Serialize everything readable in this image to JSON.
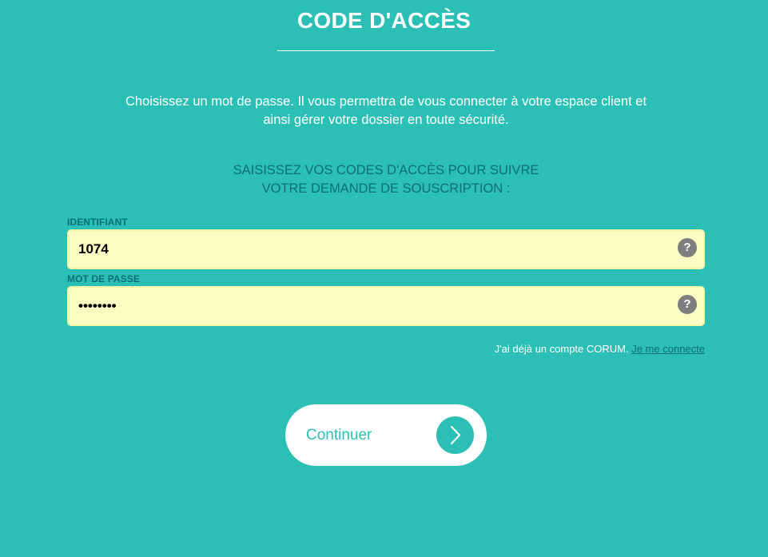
{
  "header": {
    "title": "CODE D'ACCÈS"
  },
  "intro": {
    "line1": "Choisissez un mot de passe. Il vous permettra de vous connecter à votre espace client et",
    "line2": "ainsi gérer votre dossier en toute sécurité."
  },
  "subheading": {
    "line1": "SAISISSEZ VOS CODES D'ACCÈS POUR SUIVRE",
    "line2": "VOTRE DEMANDE DE SOUSCRIPTION :"
  },
  "form": {
    "identifiant": {
      "label": "IDENTIFIANT",
      "value": "1074",
      "help_icon": "?"
    },
    "password": {
      "label": "MOT DE PASSE",
      "value": "12345678",
      "help_icon": "?"
    }
  },
  "account": {
    "text": "J'ai déjà un compte CORUM. ",
    "link_label": "Je me connecte"
  },
  "continue_button": {
    "label": "Continuer",
    "icon": "chevron-right-icon"
  },
  "colors": {
    "background": "#2bbfb6",
    "dark_text": "#0c6f75",
    "field_background": "#fafec3",
    "help_icon": "#7f7f7f"
  }
}
